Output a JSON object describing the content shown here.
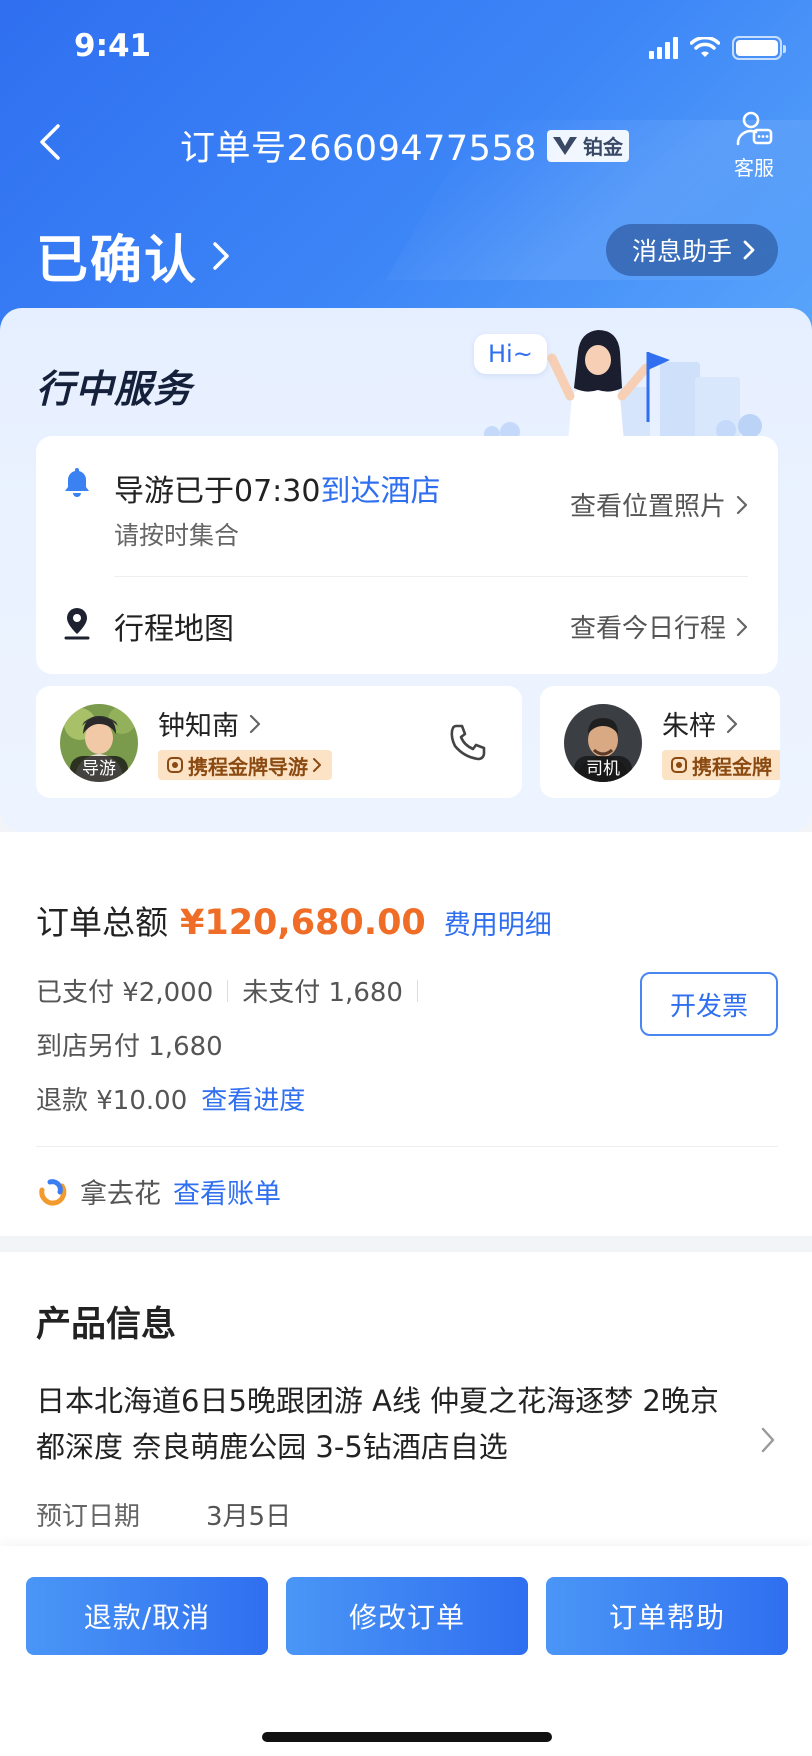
{
  "status_bar": {
    "time": "9:41"
  },
  "header": {
    "order_label": "订单号26609477558",
    "vip_label": "铂金",
    "service_label": "客服",
    "status": "已确认",
    "assistant_button": "消息助手"
  },
  "service": {
    "title": "行中服务",
    "greeting": "Hi~",
    "guide_msg_prefix": "导游已于07:30",
    "guide_msg_highlight": "到达酒店",
    "guide_sub": "请按时集合",
    "view_photos": "查看位置照片",
    "map_label": "行程地图",
    "view_itinerary": "查看今日行程",
    "people": [
      {
        "name": "钟知南",
        "role": "导游",
        "badge": "携程金牌导游"
      },
      {
        "name": "朱梓",
        "role": "司机",
        "badge": "携程金牌"
      }
    ]
  },
  "payment": {
    "total_label": "订单总额",
    "total_amount": "¥120,680.00",
    "detail_link": "费用明细",
    "paid": "已支付 ¥2,000",
    "unpaid": "未支付 1,680",
    "pay_at_hotel": "到店另付 1,680",
    "refund": "退款 ¥10.00",
    "refund_link": "查看进度",
    "invoice_button": "开发票",
    "nqh_label": "拿去花",
    "nqh_link": "查看账单"
  },
  "product": {
    "heading": "产品信息",
    "name": "日本北海道6日5晚跟团游 A线 仲夏之花海逐梦 2晚京都深度 奈良萌鹿公园 3-5钻酒店自选",
    "date_label": "预订日期",
    "date_value": "3月5日"
  },
  "actions": [
    "退款/取消",
    "修改订单",
    "订单帮助"
  ],
  "colors": {
    "primary": "#2f6ff0",
    "price": "#ef6d26",
    "badge_bg": "#fde3c6"
  }
}
